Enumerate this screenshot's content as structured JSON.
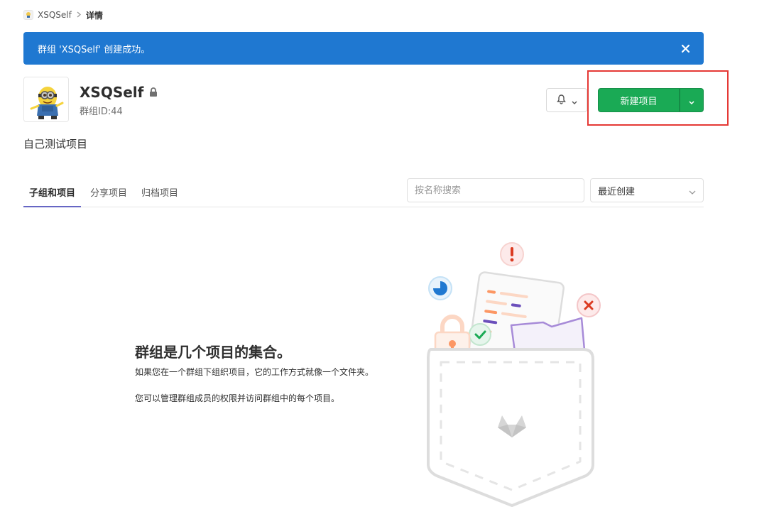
{
  "breadcrumb": {
    "group": "XSQSelf",
    "current": "详情"
  },
  "flash": {
    "message": "群组 'XSQSelf' 创建成功。"
  },
  "group": {
    "name": "XSQSelf",
    "id_text": "群组ID:44",
    "description": "自己测试项目"
  },
  "actions": {
    "new_project": "新建项目"
  },
  "tabs": [
    {
      "label": "子组和项目",
      "active": true
    },
    {
      "label": "分享项目",
      "active": false
    },
    {
      "label": "归档项目",
      "active": false
    }
  ],
  "search": {
    "placeholder": "按名称搜索",
    "value": ""
  },
  "sort": {
    "selected": "最近创建"
  },
  "empty_state": {
    "title": "群组是几个项目的集合。",
    "line1": "如果您在一个群组下组织项目，它的工作方式就像一个文件夹。",
    "line2": "您可以管理群组成员的权限并访问群组中的每个项目。"
  },
  "colors": {
    "flash": "#1f78d1",
    "primary_green": "#1aaa55",
    "tab_active": "#6666c4",
    "highlight": "#e53935"
  },
  "icons": [
    "avatar-image",
    "chevron-right-icon",
    "close-icon",
    "lock-icon",
    "bell-icon",
    "chevron-down-icon",
    "folder-illustration"
  ]
}
